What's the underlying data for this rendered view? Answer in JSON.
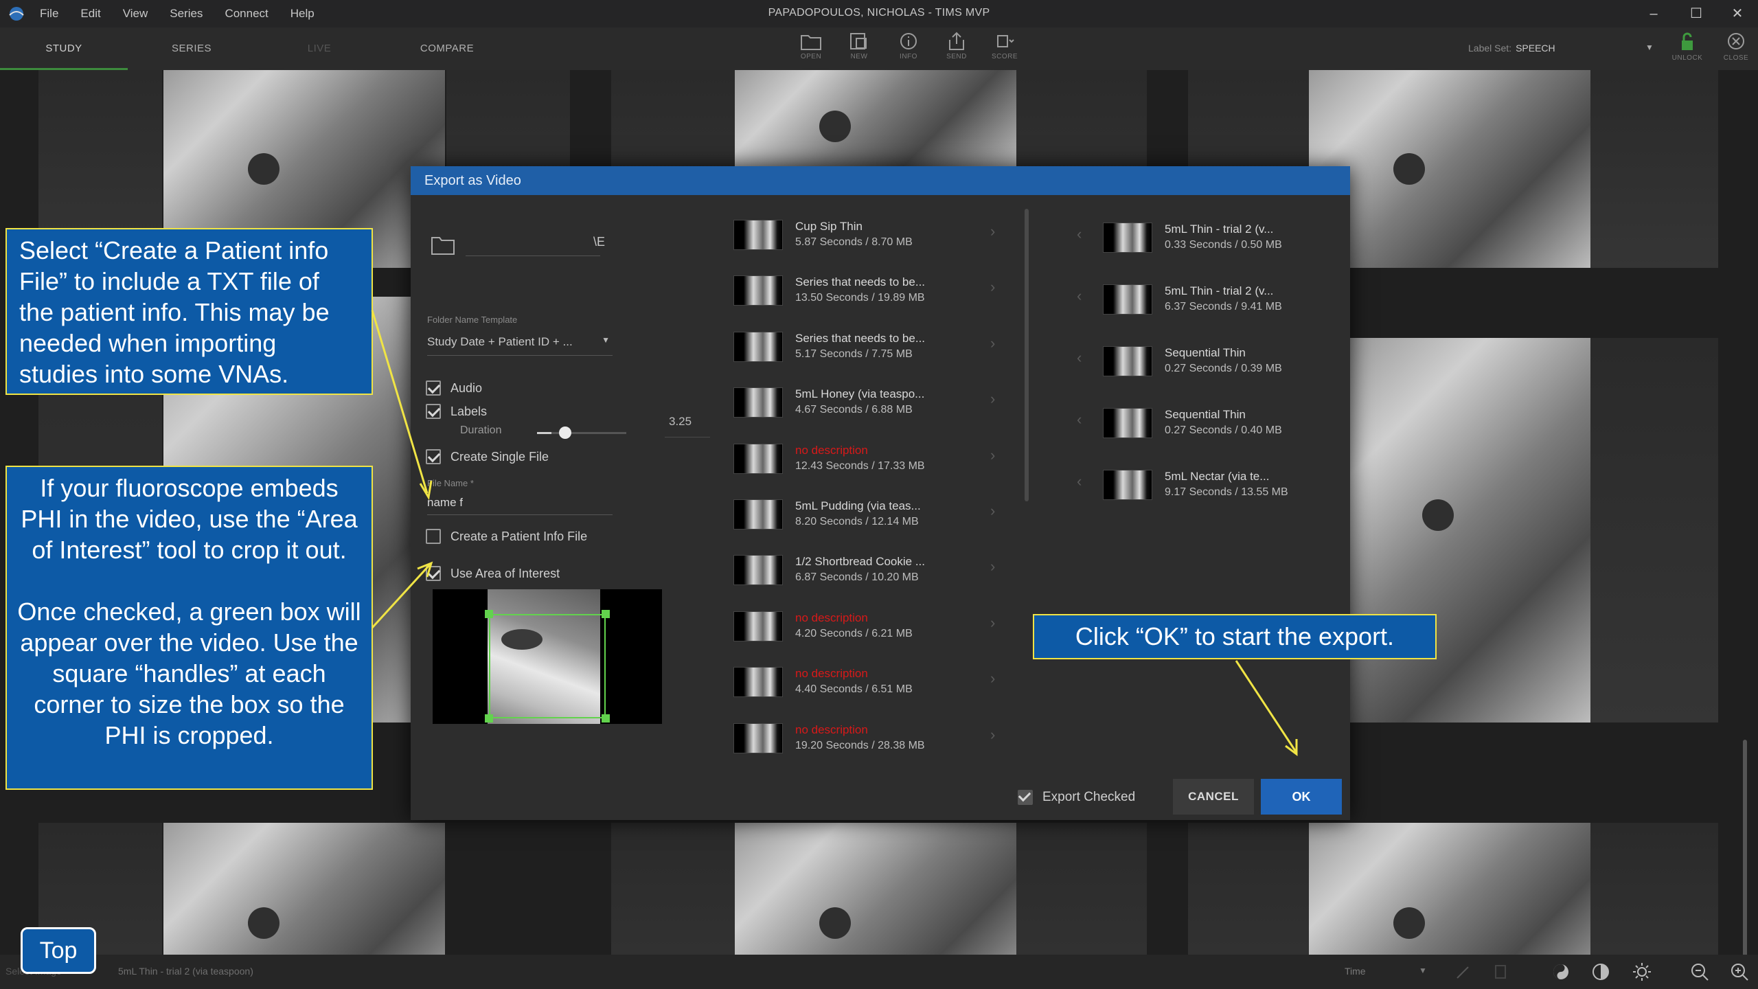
{
  "window": {
    "title": "PAPADOPOULOS, NICHOLAS - TIMS MVP",
    "menu": [
      "File",
      "Edit",
      "View",
      "Series",
      "Connect",
      "Help"
    ]
  },
  "tabs": [
    "STUDY",
    "SERIES",
    "LIVE",
    "COMPARE"
  ],
  "toolbar": [
    "OPEN",
    "NEW",
    "INFO",
    "SEND",
    "SCORE"
  ],
  "label_set": {
    "prefix": "Label Set:",
    "value": "SPEECH"
  },
  "right_tools": [
    "UNLOCK",
    "CLOSE"
  ],
  "dialog": {
    "title": "Export as Video",
    "folder_path": "\\E",
    "folder_name_template_label": "Folder Name Template",
    "folder_name_template_value": "Study Date + Patient ID + ...",
    "audio_label": "Audio",
    "labels_label": "Labels",
    "duration_label": "Duration",
    "duration_value": "3.25",
    "duration_fraction": 0.16,
    "create_single_file_label": "Create Single File",
    "file_name_label": "File Name *",
    "file_name_value": "name f",
    "patient_info_label": "Create a Patient Info File",
    "area_of_interest_label": "Use Area of Interest",
    "export_checked_label": "Export Checked",
    "cancel_label": "CANCEL",
    "ok_label": "OK"
  },
  "series_left": [
    {
      "title": "Cup Sip Thin",
      "meta": "5.87 Seconds / 8.70 MB"
    },
    {
      "title": "Series that needs to be...",
      "meta": "13.50 Seconds / 19.89 MB"
    },
    {
      "title": "Series that needs to be...",
      "meta": "5.17 Seconds / 7.75 MB"
    },
    {
      "title": "5mL Honey (via teaspo...",
      "meta": "4.67 Seconds / 6.88 MB"
    },
    {
      "title": "no description",
      "meta": "12.43 Seconds / 17.33 MB",
      "red": true
    },
    {
      "title": "5mL Pudding (via teas...",
      "meta": "8.20 Seconds / 12.14 MB"
    },
    {
      "title": "1/2 Shortbread Cookie ...",
      "meta": "6.87 Seconds / 10.20 MB"
    },
    {
      "title": "no description",
      "meta": "4.20 Seconds / 6.21 MB",
      "red": true
    },
    {
      "title": "no description",
      "meta": "4.40 Seconds / 6.51 MB",
      "red": true
    },
    {
      "title": "no description",
      "meta": "19.20 Seconds / 28.38 MB",
      "red": true
    }
  ],
  "series_right": [
    {
      "title": "5mL Thin - trial 2 (v...",
      "meta": "0.33 Seconds / 0.50 MB"
    },
    {
      "title": "5mL Thin - trial 2 (v...",
      "meta": "6.37 Seconds / 9.41 MB"
    },
    {
      "title": "Sequential Thin",
      "meta": "0.27 Seconds / 0.39 MB"
    },
    {
      "title": "Sequential Thin",
      "meta": "0.27 Seconds / 0.40 MB"
    },
    {
      "title": "5mL Nectar (via te...",
      "meta": "9.17 Seconds / 13.55 MB"
    }
  ],
  "callouts": {
    "patient_info": "Select “Create a Patient info File” to include a TXT file of the patient info. This may be needed when importing studies into some VNAs.",
    "area_of_interest_1": "If your fluoroscope embeds PHI in the video, use the “Area of Interest” tool to crop it out.",
    "area_of_interest_2": "Once checked, a green box will appear over the video. Use the square “handles” at each corner to size the box so the PHI is cropped.",
    "ok": "Click “OK” to start the export."
  },
  "top_button": "Top",
  "status": {
    "left": "Select Image",
    "series": "5mL Thin - trial 2 (via teaspoon)",
    "time_label": "Time"
  },
  "colors": {
    "dialog_header": "#1f5fa7",
    "callout_bg": "#0d5aa6",
    "callout_border": "#f0e445",
    "aoi_box": "#62d34d",
    "no_description": "#d81919",
    "active_tab_underline": "#3d8b3d"
  }
}
